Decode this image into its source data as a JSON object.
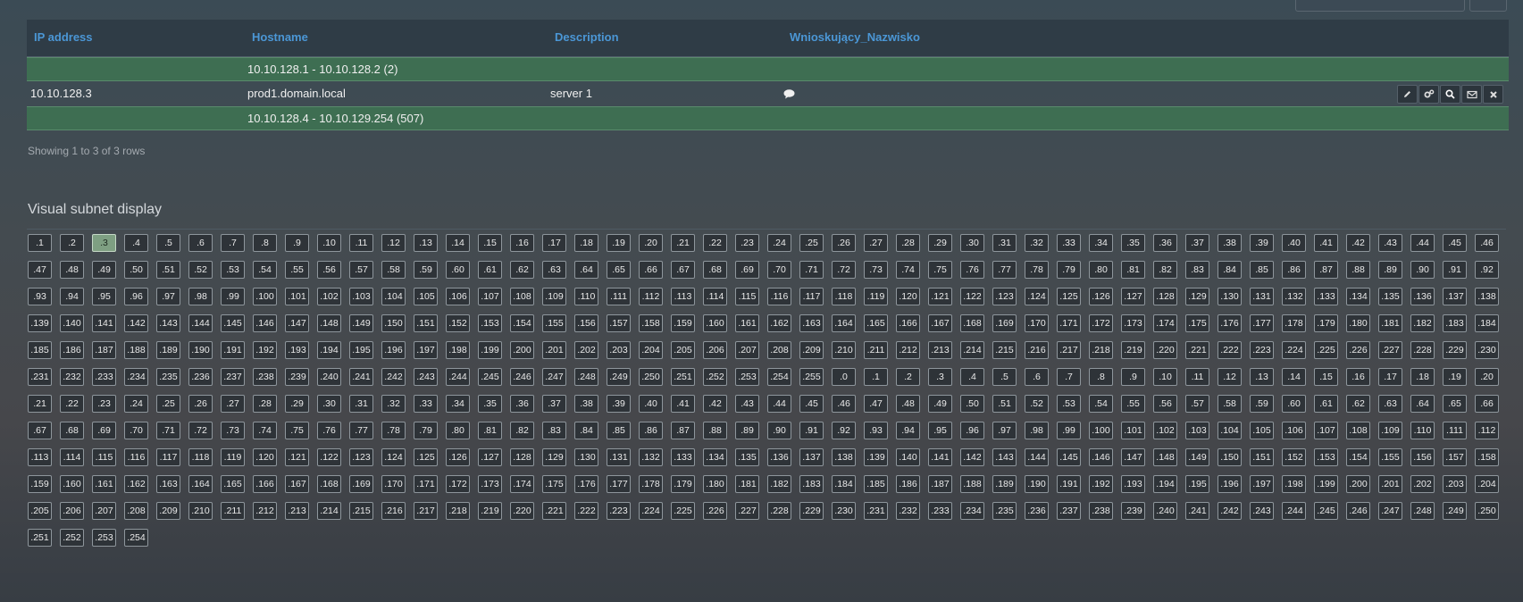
{
  "table": {
    "headers": [
      "IP address",
      "Hostname",
      "Description",
      "Wnioskujący_Nazwisko"
    ],
    "free_range_1": "10.10.128.1 - 10.10.128.2 (2)",
    "row": {
      "ip": "10.10.128.3",
      "hostname": "prod1.domain.local",
      "description": "server 1",
      "comment_icon": "comment-icon"
    },
    "free_range_2": "10.10.128.4 - 10.10.129.254 (507)",
    "actions": [
      "edit-icon",
      "manage-icon",
      "search-icon",
      "mail-icon",
      "delete-icon"
    ],
    "footer": "Showing 1 to 3 of 3 rows"
  },
  "subnet_display": {
    "title": "Visual subnet display",
    "used": [
      ".3"
    ],
    "used_color": "#7e9f82",
    "addresses": [
      ".1",
      ".2",
      ".3",
      ".4",
      ".5",
      ".6",
      ".7",
      ".8",
      ".9",
      ".10",
      ".11",
      ".12",
      ".13",
      ".14",
      ".15",
      ".16",
      ".17",
      ".18",
      ".19",
      ".20",
      ".21",
      ".22",
      ".23",
      ".24",
      ".25",
      ".26",
      ".27",
      ".28",
      ".29",
      ".30",
      ".31",
      ".32",
      ".33",
      ".34",
      ".35",
      ".36",
      ".37",
      ".38",
      ".39",
      ".40",
      ".41",
      ".42",
      ".43",
      ".44",
      ".45",
      ".46",
      ".47",
      ".48",
      ".49",
      ".50",
      ".51",
      ".52",
      ".53",
      ".54",
      ".55",
      ".56",
      ".57",
      ".58",
      ".59",
      ".60",
      ".61",
      ".62",
      ".63",
      ".64",
      ".65",
      ".66",
      ".67",
      ".68",
      ".69",
      ".70",
      ".71",
      ".72",
      ".73",
      ".74",
      ".75",
      ".76",
      ".77",
      ".78",
      ".79",
      ".80",
      ".81",
      ".82",
      ".83",
      ".84",
      ".85",
      ".86",
      ".87",
      ".88",
      ".89",
      ".90",
      ".91",
      ".92",
      ".93",
      ".94",
      ".95",
      ".96",
      ".97",
      ".98",
      ".99",
      ".100",
      ".101",
      ".102",
      ".103",
      ".104",
      ".105",
      ".106",
      ".107",
      ".108",
      ".109",
      ".110",
      ".111",
      ".112",
      ".113",
      ".114",
      ".115",
      ".116",
      ".117",
      ".118",
      ".119",
      ".120",
      ".121",
      ".122",
      ".123",
      ".124",
      ".125",
      ".126",
      ".127",
      ".128",
      ".129",
      ".130",
      ".131",
      ".132",
      ".133",
      ".134",
      ".135",
      ".136",
      ".137",
      ".138",
      ".139",
      ".140",
      ".141",
      ".142",
      ".143",
      ".144",
      ".145",
      ".146",
      ".147",
      ".148",
      ".149",
      ".150",
      ".151",
      ".152",
      ".153",
      ".154",
      ".155",
      ".156",
      ".157",
      ".158",
      ".159",
      ".160",
      ".161",
      ".162",
      ".163",
      ".164",
      ".165",
      ".166",
      ".167",
      ".168",
      ".169",
      ".170",
      ".171",
      ".172",
      ".173",
      ".174",
      ".175",
      ".176",
      ".177",
      ".178",
      ".179",
      ".180",
      ".181",
      ".182",
      ".183",
      ".184",
      ".185",
      ".186",
      ".187",
      ".188",
      ".189",
      ".190",
      ".191",
      ".192",
      ".193",
      ".194",
      ".195",
      ".196",
      ".197",
      ".198",
      ".199",
      ".200",
      ".201",
      ".202",
      ".203",
      ".204",
      ".205",
      ".206",
      ".207",
      ".208",
      ".209",
      ".210",
      ".211",
      ".212",
      ".213",
      ".214",
      ".215",
      ".216",
      ".217",
      ".218",
      ".219",
      ".220",
      ".221",
      ".222",
      ".223",
      ".224",
      ".225",
      ".226",
      ".227",
      ".228",
      ".229",
      ".230",
      ".231",
      ".232",
      ".233",
      ".234",
      ".235",
      ".236",
      ".237",
      ".238",
      ".239",
      ".240",
      ".241",
      ".242",
      ".243",
      ".244",
      ".245",
      ".246",
      ".247",
      ".248",
      ".249",
      ".250",
      ".251",
      ".252",
      ".253",
      ".254",
      ".255",
      ".0",
      ".1",
      ".2",
      ".3",
      ".4",
      ".5",
      ".6",
      ".7",
      ".8",
      ".9",
      ".10",
      ".11",
      ".12",
      ".13",
      ".14",
      ".15",
      ".16",
      ".17",
      ".18",
      ".19",
      ".20",
      ".21",
      ".22",
      ".23",
      ".24",
      ".25",
      ".26",
      ".27",
      ".28",
      ".29",
      ".30",
      ".31",
      ".32",
      ".33",
      ".34",
      ".35",
      ".36",
      ".37",
      ".38",
      ".39",
      ".40",
      ".41",
      ".42",
      ".43",
      ".44",
      ".45",
      ".46",
      ".47",
      ".48",
      ".49",
      ".50",
      ".51",
      ".52",
      ".53",
      ".54",
      ".55",
      ".56",
      ".57",
      ".58",
      ".59",
      ".60",
      ".61",
      ".62",
      ".63",
      ".64",
      ".65",
      ".66",
      ".67",
      ".68",
      ".69",
      ".70",
      ".71",
      ".72",
      ".73",
      ".74",
      ".75",
      ".76",
      ".77",
      ".78",
      ".79",
      ".80",
      ".81",
      ".82",
      ".83",
      ".84",
      ".85",
      ".86",
      ".87",
      ".88",
      ".89",
      ".90",
      ".91",
      ".92",
      ".93",
      ".94",
      ".95",
      ".96",
      ".97",
      ".98",
      ".99",
      ".100",
      ".101",
      ".102",
      ".103",
      ".104",
      ".105",
      ".106",
      ".107",
      ".108",
      ".109",
      ".110",
      ".111",
      ".112",
      ".113",
      ".114",
      ".115",
      ".116",
      ".117",
      ".118",
      ".119",
      ".120",
      ".121",
      ".122",
      ".123",
      ".124",
      ".125",
      ".126",
      ".127",
      ".128",
      ".129",
      ".130",
      ".131",
      ".132",
      ".133",
      ".134",
      ".135",
      ".136",
      ".137",
      ".138",
      ".139",
      ".140",
      ".141",
      ".142",
      ".143",
      ".144",
      ".145",
      ".146",
      ".147",
      ".148",
      ".149",
      ".150",
      ".151",
      ".152",
      ".153",
      ".154",
      ".155",
      ".156",
      ".157",
      ".158",
      ".159",
      ".160",
      ".161",
      ".162",
      ".163",
      ".164",
      ".165",
      ".166",
      ".167",
      ".168",
      ".169",
      ".170",
      ".171",
      ".172",
      ".173",
      ".174",
      ".175",
      ".176",
      ".177",
      ".178",
      ".179",
      ".180",
      ".181",
      ".182",
      ".183",
      ".184",
      ".185",
      ".186",
      ".187",
      ".188",
      ".189",
      ".190",
      ".191",
      ".192",
      ".193",
      ".194",
      ".195",
      ".196",
      ".197",
      ".198",
      ".199",
      ".200",
      ".201",
      ".202",
      ".203",
      ".204",
      ".205",
      ".206",
      ".207",
      ".208",
      ".209",
      ".210",
      ".211",
      ".212",
      ".213",
      ".214",
      ".215",
      ".216",
      ".217",
      ".218",
      ".219",
      ".220",
      ".221",
      ".222",
      ".223",
      ".224",
      ".225",
      ".226",
      ".227",
      ".228",
      ".229",
      ".230",
      ".231",
      ".232",
      ".233",
      ".234",
      ".235",
      ".236",
      ".237",
      ".238",
      ".239",
      ".240",
      ".241",
      ".242",
      ".243",
      ".244",
      ".245",
      ".246",
      ".247",
      ".248",
      ".249",
      ".250",
      ".251",
      ".252",
      ".253",
      ".254"
    ]
  }
}
